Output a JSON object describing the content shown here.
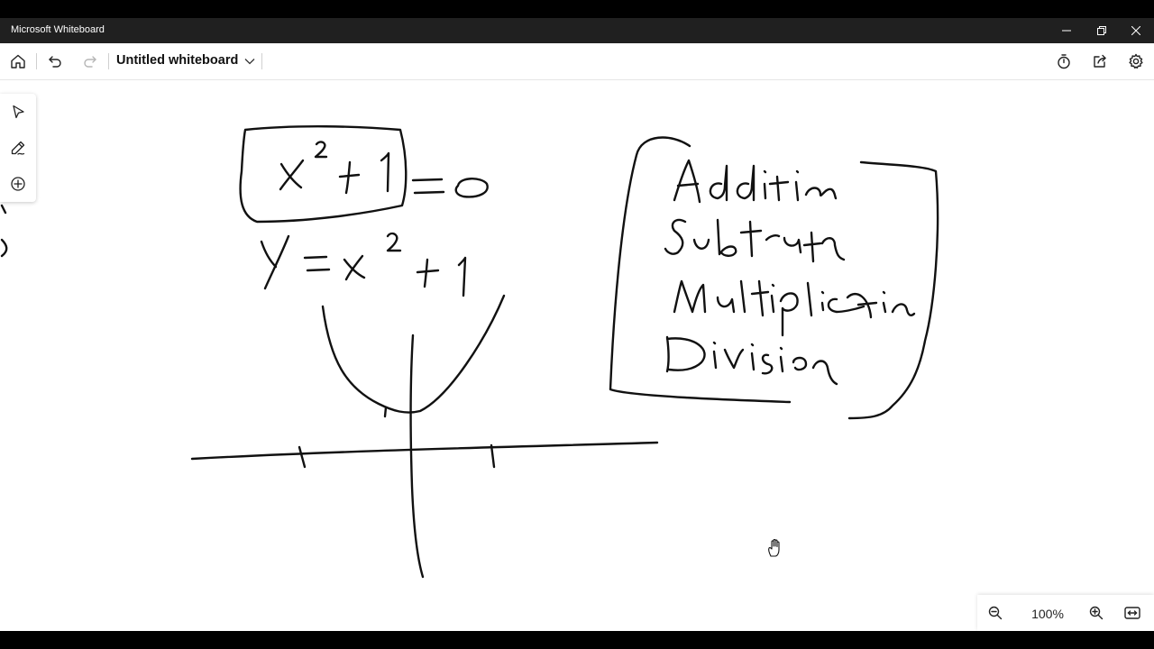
{
  "window": {
    "app_title": "Microsoft Whiteboard"
  },
  "toolbar": {
    "board_title": "Untitled whiteboard"
  },
  "zoom": {
    "level_label": "100%"
  },
  "icons": {
    "home": "home-icon",
    "undo": "undo-icon",
    "redo": "redo-icon",
    "timer": "timer-icon",
    "share": "share-icon",
    "settings": "gear-icon",
    "select": "pointer-icon",
    "pen": "pen-icon",
    "add": "plus-circle-icon",
    "zoom_out": "zoom-out-icon",
    "zoom_in": "zoom-in-icon",
    "fit": "fit-to-screen-icon"
  },
  "colors": {
    "titlebar_bg": "#202020",
    "canvas_bg": "#ffffff",
    "ink": "#111111"
  }
}
